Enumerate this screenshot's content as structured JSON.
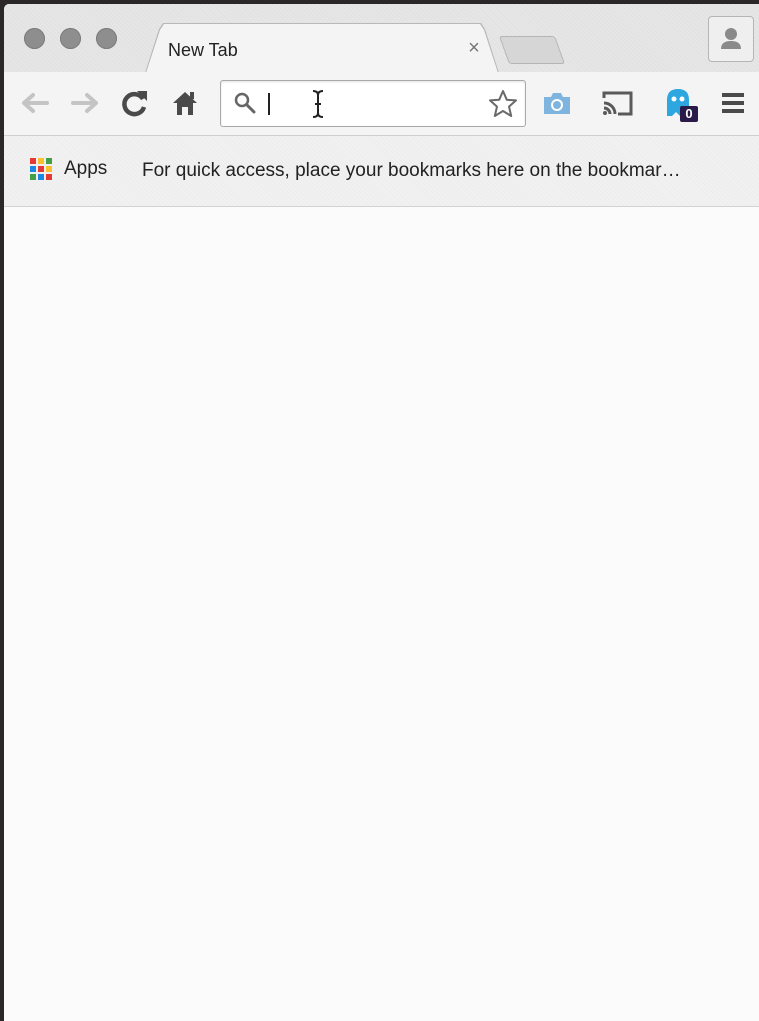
{
  "tab": {
    "title": "New Tab",
    "close_glyph": "×"
  },
  "omnibox": {
    "value": "",
    "placeholder": ""
  },
  "toolbar": {
    "extension_badge_count": "0"
  },
  "bookmarks_bar": {
    "apps_label": "Apps",
    "hint": "For quick access, place your bookmarks here on the bookmar…"
  },
  "icons": {
    "window_controls": [
      "close-icon",
      "minimize-icon",
      "zoom-icon"
    ],
    "toolbar": [
      "back-arrow-icon",
      "forward-arrow-icon",
      "reload-icon",
      "home-icon",
      "search-icon",
      "star-icon",
      "camera-icon",
      "cast-icon",
      "ghostery-icon",
      "menu-icon"
    ],
    "profile": "person-icon"
  },
  "colors": {
    "ghost_blue": "#2ea7e0",
    "badge_bg": "#2a1a4a",
    "camera_blue": "#7fb4df",
    "apps_grid": [
      "#e53935",
      "#fbc02d",
      "#43a047",
      "#1e88e5",
      "#e53935",
      "#fbc02d",
      "#43a047",
      "#1e88e5",
      "#e53935"
    ]
  }
}
